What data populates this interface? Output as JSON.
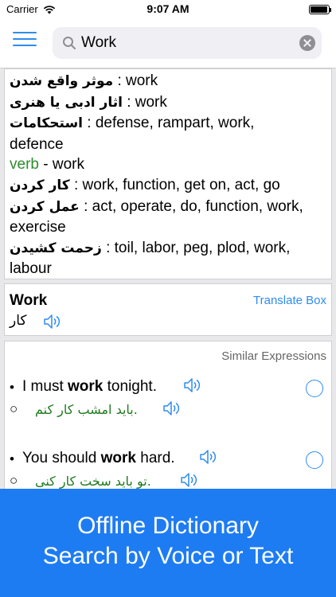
{
  "status_bar": {
    "carrier": "Carrier",
    "time": "9:07 AM"
  },
  "search": {
    "value": "Work",
    "placeholder": ""
  },
  "definitions": [
    {
      "fa": "موثر واقع شدن",
      "en": " : work"
    },
    {
      "fa": "اثار ادبی یا هنری",
      "en": " : work"
    },
    {
      "fa": "استحکامات",
      "en": " : defense, rampart, work,"
    },
    {
      "fa": "",
      "en": "defence"
    },
    {
      "pos": "verb",
      "en": " - work"
    },
    {
      "fa": "کار کردن",
      "en": " : work, function, get on, act, go"
    },
    {
      "fa": "عمل کردن",
      "en": " : act, operate, do, function, work,"
    },
    {
      "fa": "",
      "en": "exercise"
    },
    {
      "fa": "زحمت کشیدن",
      "en": " : toil, labor, peg, plod, work,"
    },
    {
      "fa": "",
      "en": "labour"
    }
  ],
  "word_card": {
    "title": "Work",
    "translation": "کار",
    "translate_box_label": "Translate Box"
  },
  "similar": {
    "header": "Similar Expressions",
    "examples": [
      {
        "en_pre": "I must ",
        "en_bold": "work",
        "en_post": " tonight.",
        "fa": ".باید امشب کار کنم"
      },
      {
        "en_pre": "You should ",
        "en_bold": "work",
        "en_post": " hard.",
        "fa": ".تو باید سخت کار کنی"
      }
    ],
    "bullet": "•",
    "sub_bullet": "○"
  },
  "banner": {
    "line1": "Offline Dictionary",
    "line2": "Search by Voice or Text"
  },
  "colors": {
    "accent": "#2f8cf0",
    "banner": "#1e7cf2",
    "verb_green": "#2e8b2e",
    "farsi_green": "#1f7a1f"
  }
}
